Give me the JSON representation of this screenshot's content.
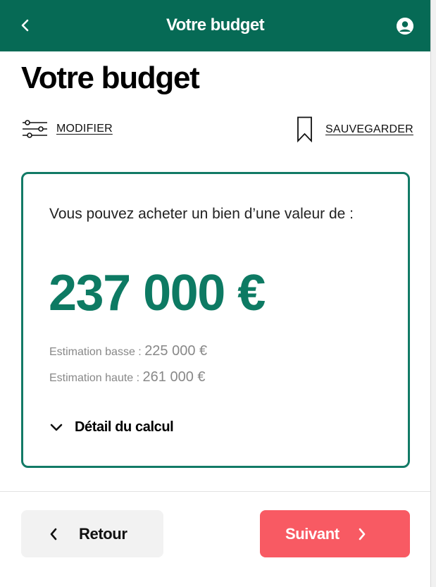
{
  "header": {
    "title": "Votre budget",
    "back_icon": "chevron-left-icon",
    "account_icon": "user-avatar-icon",
    "color": "#066a55"
  },
  "page": {
    "title": "Votre budget"
  },
  "actions": {
    "modify_label": "MODIFIER",
    "modify_icon": "sliders-icon",
    "save_label": "SAUVEGARDER",
    "save_icon": "bookmark-icon"
  },
  "result": {
    "intro": "Vous pouvez acheter un bien d’une valeur de :",
    "amount": "237 000 €",
    "low_label": "Estimation basse :",
    "low_value": "225 000 €",
    "high_label": "Estimation haute :",
    "high_value": "261 000 €",
    "detail_label": "Détail du calcul",
    "detail_icon": "chevron-down-icon",
    "accent_color": "#0d7a63"
  },
  "footer": {
    "back_label": "Retour",
    "back_icon": "chevron-left-icon",
    "next_label": "Suivant",
    "next_icon": "chevron-right-icon",
    "next_color": "#f85a63"
  }
}
